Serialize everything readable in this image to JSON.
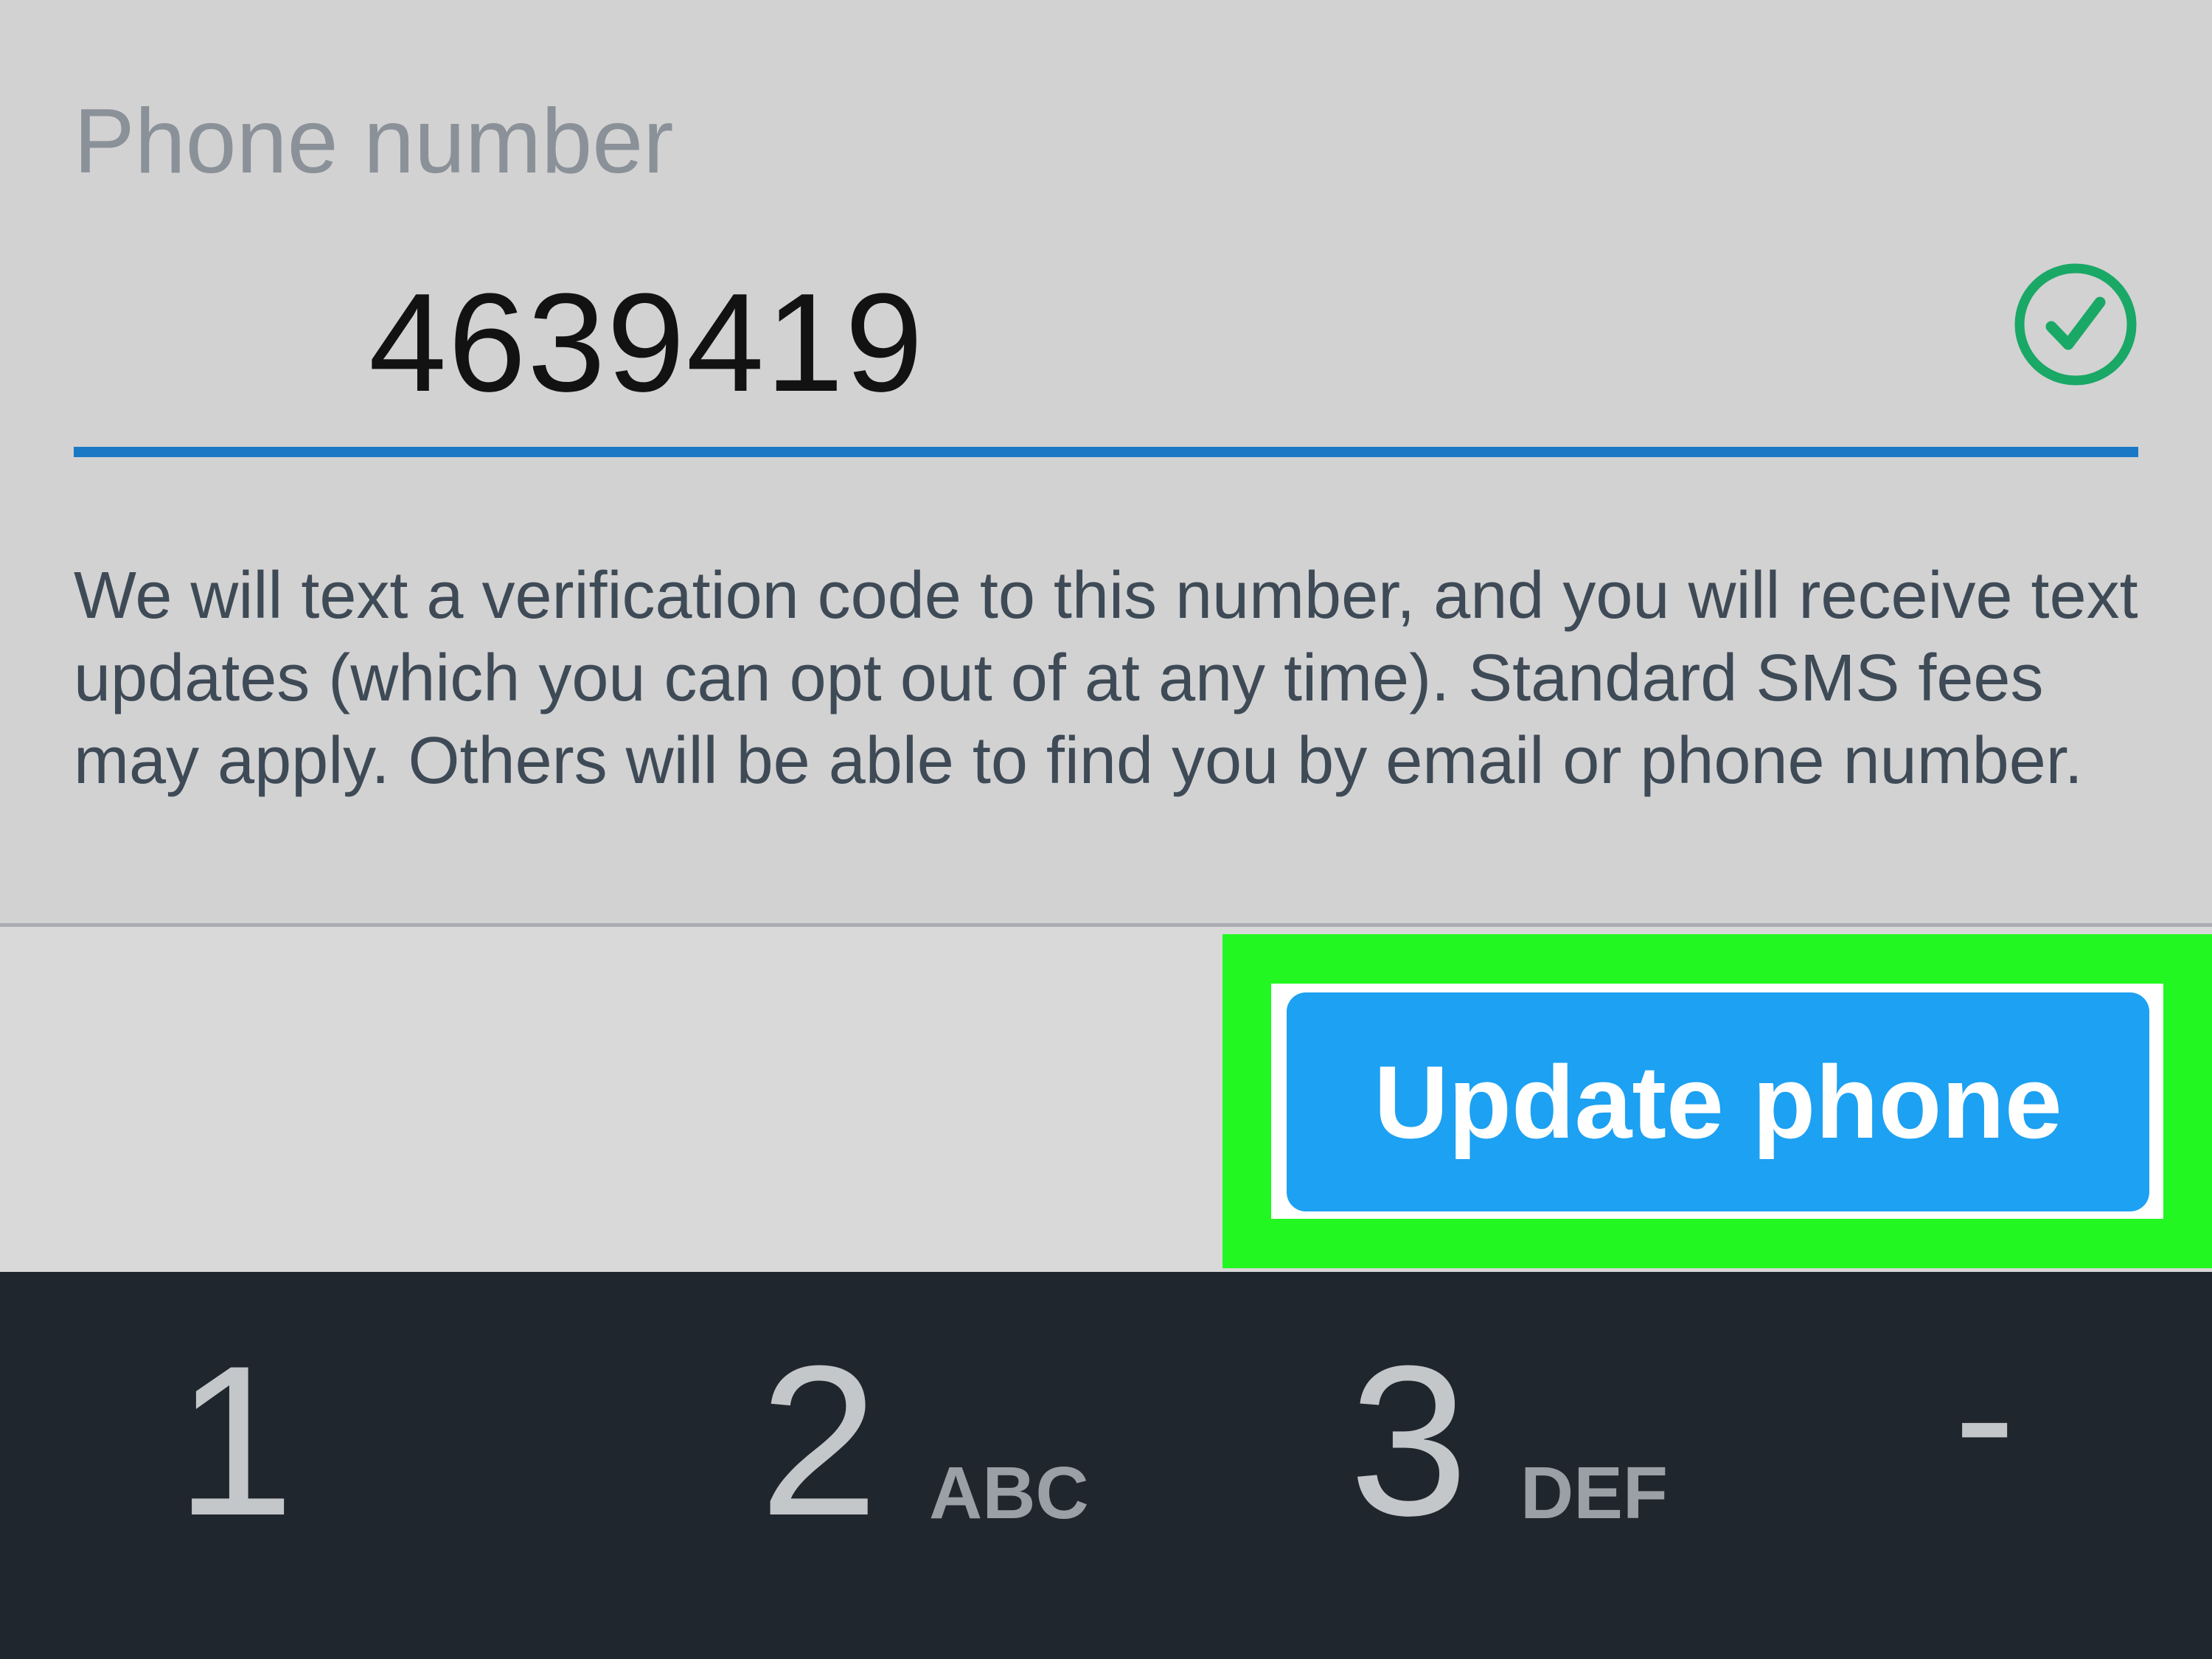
{
  "form": {
    "phone_label": "Phone number",
    "phone_value": "4639419",
    "valid_icon": "check-circle-icon",
    "disclaimer": "We will text a verification code to this number, and you will receive text updates (which you can opt out of at any time). Standard SMS fees may apply. Others will be able to find you by email or phone number."
  },
  "actions": {
    "update_label": "Update phone"
  },
  "keypad": {
    "keys": [
      {
        "digit": "1",
        "letters": ""
      },
      {
        "digit": "2",
        "letters": "ABC"
      },
      {
        "digit": "3",
        "letters": "DEF"
      },
      {
        "digit": "-",
        "letters": ""
      }
    ]
  },
  "colors": {
    "accent_blue": "#1da1f2",
    "underline_blue": "#1b78c5",
    "check_green": "#1aa866",
    "highlight_green": "#22f722",
    "keypad_bg": "#20262d"
  }
}
